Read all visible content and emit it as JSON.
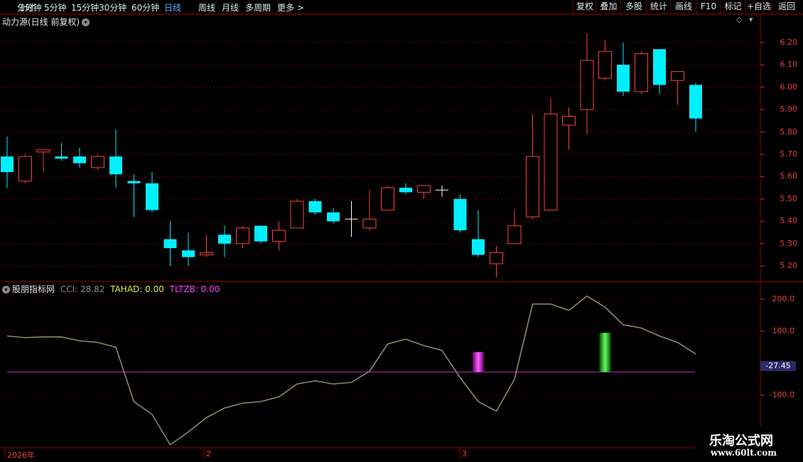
{
  "toolbar": {
    "left": [
      "分时",
      "1分钟",
      "5分钟",
      "15分钟",
      "30分钟",
      "60分钟",
      "日线",
      "周线",
      "月线",
      "多周期",
      "更多 >"
    ],
    "active": "日线",
    "right": [
      "复权",
      "叠加",
      "多股",
      "统计",
      "画线",
      "F10",
      "标记",
      "+自选",
      "返回"
    ]
  },
  "main": {
    "title": "动力源(日线 前复权)",
    "price_axis": [
      "6.20",
      "6.10",
      "6.00",
      "5.90",
      "5.80",
      "5.70",
      "5.60",
      "5.50",
      "5.40",
      "5.30",
      "5.20"
    ]
  },
  "indicator": {
    "name": "股朋指标网",
    "cci_label": "CCI: 28.82",
    "tahad_label": "TAHAD: 0.00",
    "tlzb_label": "TLTZB: 0.00",
    "axis": [
      "200.0",
      "100.0",
      "-100.0"
    ],
    "current_value": "-27.45"
  },
  "dates": [
    "2026年",
    "2",
    "3"
  ],
  "watermark": {
    "title": "乐淘公式网",
    "url": "www.60lt.com"
  },
  "colors": {
    "up": "#ff4040",
    "down": "#00f0ff",
    "cci": "#8a8a6a",
    "zero": "#c030c0",
    "tahad": "#ff40ff",
    "tlzb": "#30ff30"
  },
  "chart_data": {
    "type": "candlestick",
    "series": [
      {
        "o": 5.69,
        "h": 5.78,
        "l": 5.55,
        "c": 5.62
      },
      {
        "o": 5.58,
        "h": 5.7,
        "l": 5.57,
        "c": 5.69
      },
      {
        "o": 5.71,
        "h": 5.72,
        "l": 5.62,
        "c": 5.72
      },
      {
        "o": 5.69,
        "h": 5.75,
        "l": 5.67,
        "c": 5.68
      },
      {
        "o": 5.69,
        "h": 5.73,
        "l": 5.64,
        "c": 5.66
      },
      {
        "o": 5.64,
        "h": 5.7,
        "l": 5.63,
        "c": 5.69
      },
      {
        "o": 5.69,
        "h": 5.81,
        "l": 5.55,
        "c": 5.61
      },
      {
        "o": 5.58,
        "h": 5.61,
        "l": 5.42,
        "c": 5.57
      },
      {
        "o": 5.57,
        "h": 5.62,
        "l": 5.44,
        "c": 5.45
      },
      {
        "o": 5.32,
        "h": 5.4,
        "l": 5.2,
        "c": 5.28
      },
      {
        "o": 5.27,
        "h": 5.35,
        "l": 5.2,
        "c": 5.24
      },
      {
        "o": 5.25,
        "h": 5.34,
        "l": 5.24,
        "c": 5.26
      },
      {
        "o": 5.34,
        "h": 5.38,
        "l": 5.24,
        "c": 5.3
      },
      {
        "o": 5.3,
        "h": 5.38,
        "l": 5.28,
        "c": 5.37
      },
      {
        "o": 5.38,
        "h": 5.38,
        "l": 5.3,
        "c": 5.31
      },
      {
        "o": 5.31,
        "h": 5.4,
        "l": 5.27,
        "c": 5.36
      },
      {
        "o": 5.37,
        "h": 5.5,
        "l": 5.37,
        "c": 5.49
      },
      {
        "o": 5.49,
        "h": 5.5,
        "l": 5.43,
        "c": 5.44
      },
      {
        "o": 5.44,
        "h": 5.46,
        "l": 5.39,
        "c": 5.4
      },
      {
        "o": 5.41,
        "h": 5.49,
        "l": 5.33,
        "c": 5.41
      },
      {
        "o": 5.37,
        "h": 5.54,
        "l": 5.36,
        "c": 5.41
      },
      {
        "o": 5.45,
        "h": 5.56,
        "l": 5.45,
        "c": 5.55
      },
      {
        "o": 5.55,
        "h": 5.57,
        "l": 5.52,
        "c": 5.53
      },
      {
        "o": 5.53,
        "h": 5.56,
        "l": 5.5,
        "c": 5.56
      },
      {
        "o": 5.54,
        "h": 5.56,
        "l": 5.51,
        "c": 5.54
      },
      {
        "o": 5.5,
        "h": 5.52,
        "l": 5.35,
        "c": 5.36
      },
      {
        "o": 5.32,
        "h": 5.45,
        "l": 5.24,
        "c": 5.25
      },
      {
        "o": 5.21,
        "h": 5.29,
        "l": 5.15,
        "c": 5.26
      },
      {
        "o": 5.3,
        "h": 5.45,
        "l": 5.3,
        "c": 5.38
      },
      {
        "o": 5.42,
        "h": 5.88,
        "l": 5.41,
        "c": 5.69
      },
      {
        "o": 5.45,
        "h": 5.95,
        "l": 5.45,
        "c": 5.88
      },
      {
        "o": 5.83,
        "h": 5.91,
        "l": 5.72,
        "c": 5.87
      },
      {
        "o": 5.9,
        "h": 6.24,
        "l": 5.79,
        "c": 6.12
      },
      {
        "o": 6.04,
        "h": 6.21,
        "l": 6.03,
        "c": 6.16
      },
      {
        "o": 6.1,
        "h": 6.2,
        "l": 5.96,
        "c": 5.98
      },
      {
        "o": 5.98,
        "h": 6.16,
        "l": 5.97,
        "c": 6.15
      },
      {
        "o": 6.17,
        "h": 6.17,
        "l": 5.97,
        "c": 6.01
      },
      {
        "o": 6.03,
        "h": 6.07,
        "l": 5.92,
        "c": 6.07
      },
      {
        "o": 6.01,
        "h": 6.02,
        "l": 5.8,
        "c": 5.86
      }
    ],
    "cci": [
      85,
      80,
      82,
      82,
      70,
      65,
      50,
      -120,
      -160,
      -255,
      -215,
      -170,
      -140,
      -125,
      -120,
      -105,
      -65,
      -55,
      -65,
      -60,
      -25,
      60,
      75,
      55,
      40,
      -45,
      -120,
      -150,
      -50,
      185,
      185,
      165,
      210,
      175,
      120,
      110,
      85,
      65,
      28.82
    ],
    "tahad_bar_index": 26,
    "tlzb_bar_index": 33,
    "price_range": [
      5.15,
      6.25
    ],
    "cci_range": [
      -260,
      220
    ]
  }
}
